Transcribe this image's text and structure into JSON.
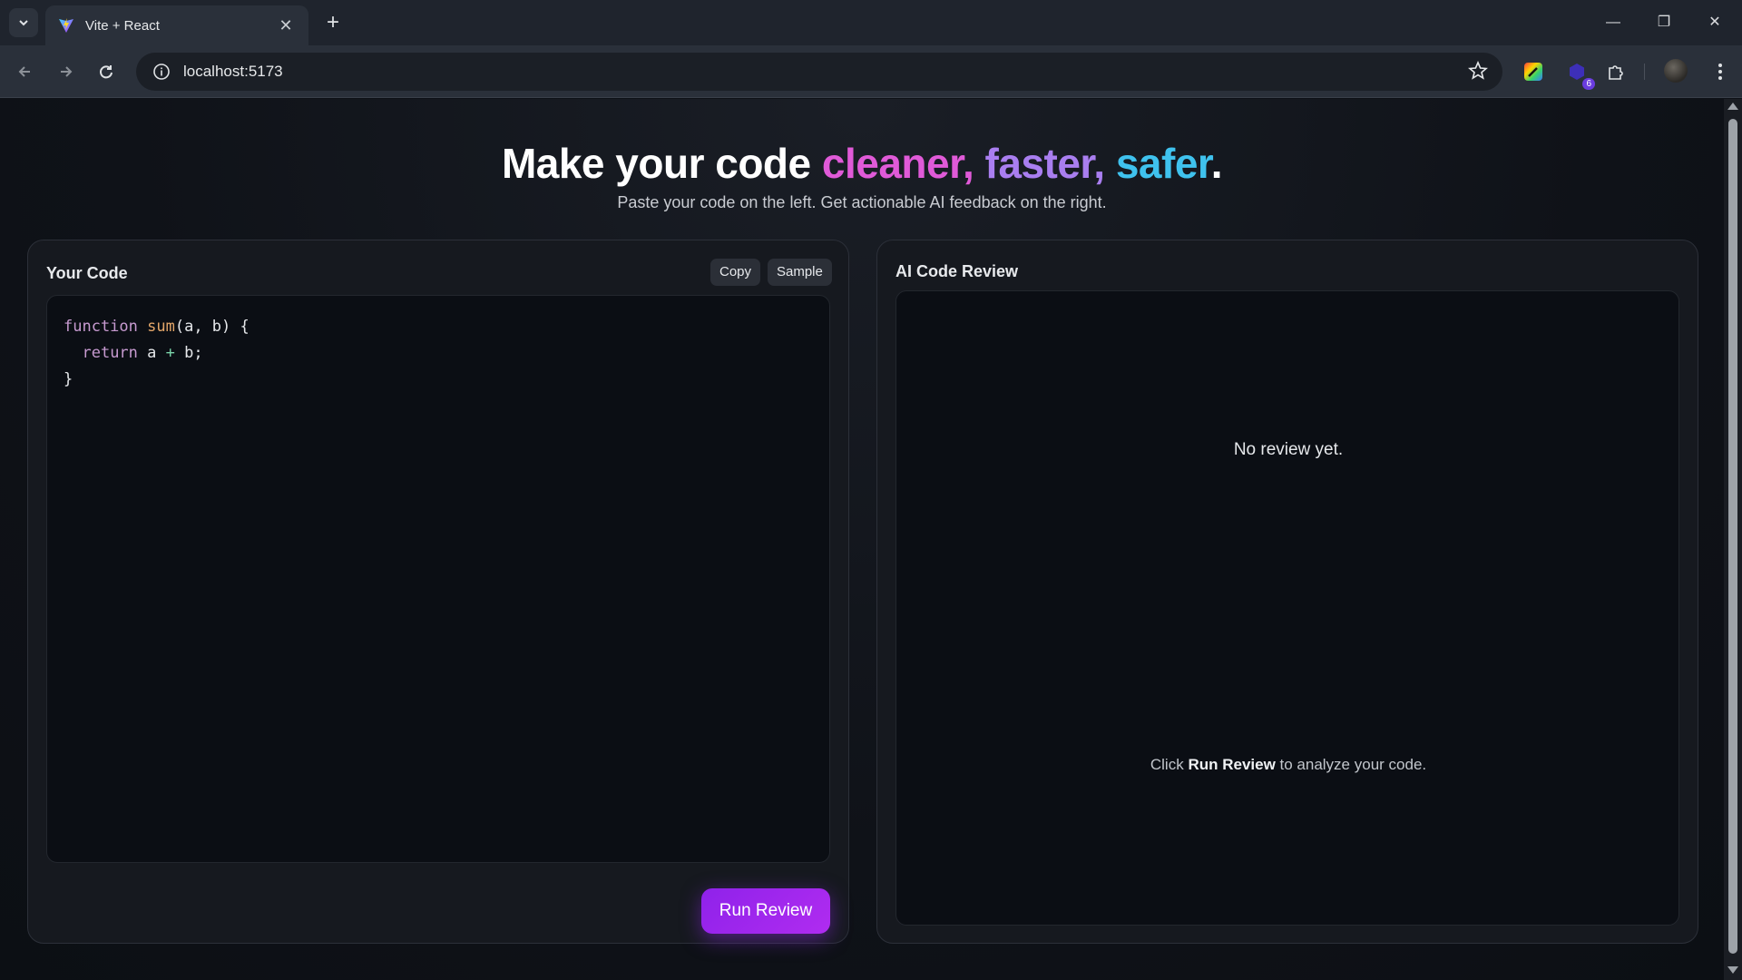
{
  "browser": {
    "tab_title": "Vite + React",
    "tab_close": "✕",
    "new_tab": "+",
    "url": "localhost:5173",
    "extension_badge": "6",
    "window_controls": {
      "minimize": "—",
      "restore": "❐",
      "close": "✕"
    }
  },
  "hero": {
    "title_prefix": "Make your code ",
    "word1": "cleaner,",
    "word2": "faster,",
    "word3": "safer",
    "period": ".",
    "subtitle": "Paste your code on the left. Get actionable AI feedback on the right."
  },
  "editor_panel": {
    "title": "Your Code",
    "copy_label": "Copy",
    "sample_label": "Sample",
    "code": {
      "l1_kw": "function",
      "l1_fn": "sum",
      "l1_rest": "(a, b) {",
      "l2_kw": "return",
      "l2_a": " a ",
      "l2_op": "+",
      "l2_b": " b;",
      "l3": "}"
    },
    "run_label": "Run Review"
  },
  "review_panel": {
    "title": "AI Code Review",
    "empty_title": "No review yet.",
    "hint_prefix": "Click ",
    "hint_bold": "Run Review",
    "hint_suffix": " to analyze your code."
  },
  "colors": {
    "accent_pink": "#e05ad8",
    "accent_violet": "#a97ef0",
    "accent_cyan": "#3fc2ee",
    "run_button": "#9b25ee"
  }
}
